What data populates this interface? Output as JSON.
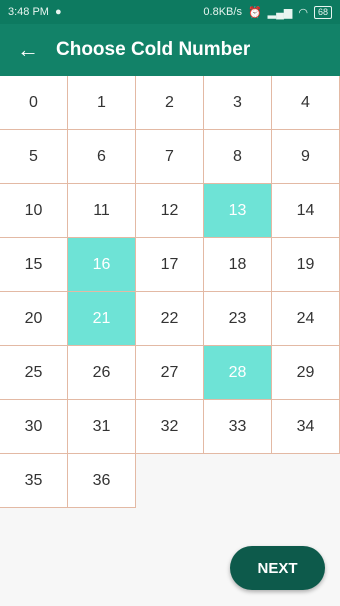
{
  "status_bar": {
    "time": "3:48 PM",
    "speed": "0.8KB/s",
    "battery": "68"
  },
  "toolbar": {
    "back_icon": "arrow-left-icon",
    "title": "Choose Cold Number"
  },
  "grid": {
    "numbers": [
      "0",
      "1",
      "2",
      "3",
      "4",
      "5",
      "6",
      "7",
      "8",
      "9",
      "10",
      "11",
      "12",
      "13",
      "14",
      "15",
      "16",
      "17",
      "18",
      "19",
      "20",
      "21",
      "22",
      "23",
      "24",
      "25",
      "26",
      "27",
      "28",
      "29",
      "30",
      "31",
      "32",
      "33",
      "34",
      "35",
      "36"
    ],
    "selected": [
      "13",
      "16",
      "21",
      "28"
    ]
  },
  "next_button": {
    "label": "NEXT"
  },
  "colors": {
    "primary": "#128268",
    "status": "#0d7a60",
    "selected": "#6ee3d6",
    "button": "#0d5a4b",
    "border": "#e3b9a4"
  }
}
